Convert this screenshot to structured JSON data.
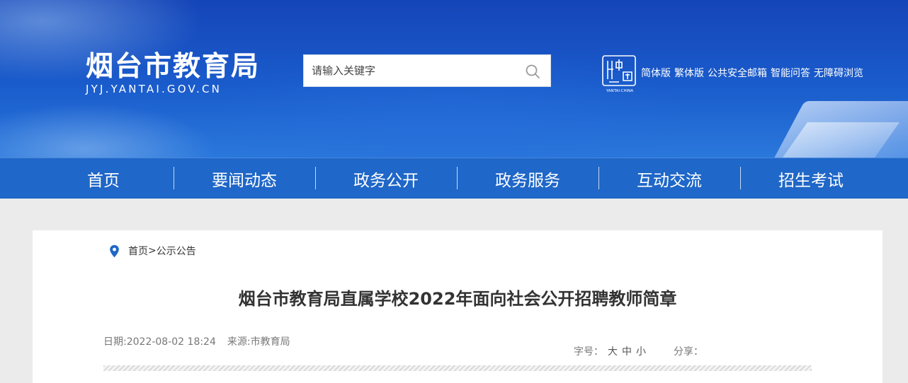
{
  "header": {
    "site_title": "烟台市教育局",
    "site_domain": "JYJ.YANTAI.GOV.CN",
    "search": {
      "placeholder": "请输入关键字",
      "value": ""
    },
    "top_links": [
      "简体版",
      "繁体版",
      "公共安全邮箱",
      "智能问答",
      "无障碍浏览"
    ],
    "colors": {
      "banner": "#1a5ccc",
      "nav": "#1f67c8"
    }
  },
  "nav": {
    "items": [
      "首页",
      "要闻动态",
      "政务公开",
      "政务服务",
      "互动交流",
      "招生考试"
    ]
  },
  "breadcrumb": {
    "home": "首页",
    "separator": ">",
    "current": "公示公告"
  },
  "article": {
    "title": "烟台市教育局直属学校2022年面向社会公开招聘教师简章",
    "date_label": "日期:",
    "date": "2022-08-02 18:24",
    "source_label": "来源:",
    "source": "市教育局",
    "font_size_label": "字号：",
    "font_sizes": [
      "大",
      "中",
      "小"
    ],
    "share_label": "分享："
  }
}
